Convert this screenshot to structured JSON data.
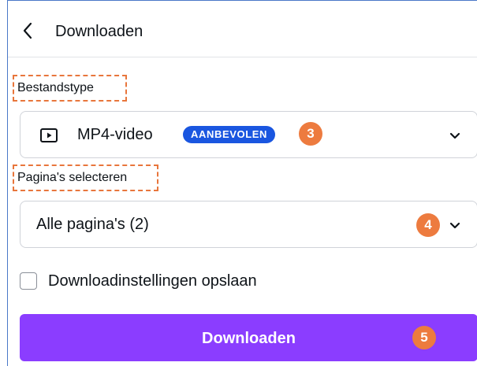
{
  "header": {
    "back_icon": "chevron-left-icon",
    "title": "Downloaden"
  },
  "file_type": {
    "label": "Bestandstype",
    "selected_icon": "video-play-icon",
    "selected_value": "MP4-video",
    "badge": "AANBEVOLEN",
    "step_marker": "3",
    "chevron_icon": "chevron-down-icon"
  },
  "pages": {
    "label": "Pagina's selecteren",
    "selected_value": "Alle pagina's (2)",
    "step_marker": "4",
    "chevron_icon": "chevron-down-icon"
  },
  "save_settings": {
    "label": "Downloadinstellingen opslaan",
    "checked": false
  },
  "download_button": {
    "label": "Downloaden",
    "step_marker": "5"
  },
  "colors": {
    "accent_purple": "#8b3dff",
    "badge_blue": "#1a56e0",
    "step_orange": "#ed7b3f",
    "highlight_dash": "#e8763c"
  }
}
